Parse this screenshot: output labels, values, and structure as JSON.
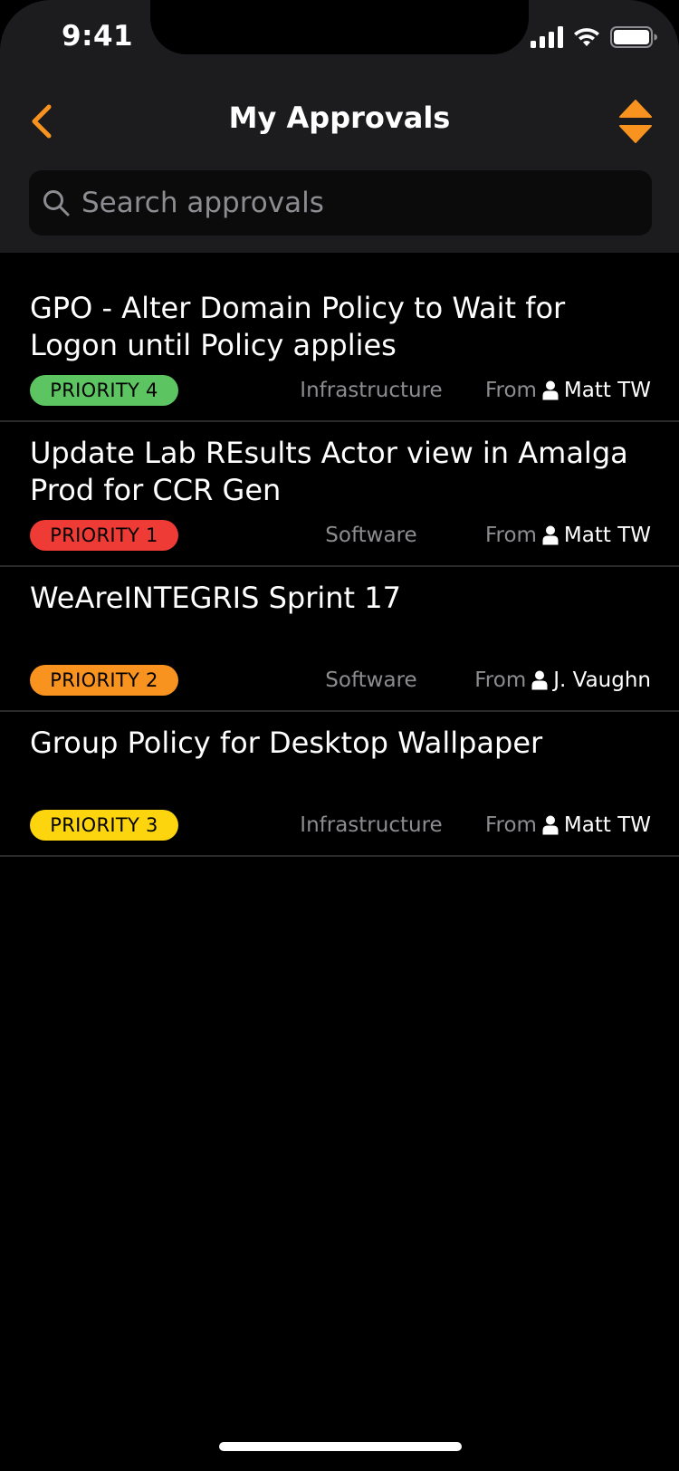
{
  "status_bar": {
    "time": "9:41"
  },
  "nav": {
    "title": "My Approvals",
    "back_icon": "chevron-left-icon",
    "sort_icon": "sort-icon",
    "accent_color": "#f7931e"
  },
  "search": {
    "placeholder": "Search approvals",
    "value": ""
  },
  "approvals": [
    {
      "title": "GPO - Alter Domain Policy to Wait for Logon until Policy applies",
      "priority": "PRIORITY 4",
      "priority_color": "#5cc461",
      "category": "Infrastructure",
      "from_label": "From",
      "from_name": "Matt TW"
    },
    {
      "title": "Update Lab REsults Actor view in Amalga Prod for CCR Gen",
      "priority": "PRIORITY 1",
      "priority_color": "#ef3b36",
      "category": "Software",
      "from_label": "From",
      "from_name": "Matt TW"
    },
    {
      "title": "WeAreINTEGRIS Sprint 17",
      "priority": "PRIORITY 2",
      "priority_color": "#f7931e",
      "category": "Software",
      "from_label": "From",
      "from_name": "J. Vaughn"
    },
    {
      "title": "Group Policy for Desktop Wallpaper",
      "priority": "PRIORITY 3",
      "priority_color": "#fdd50f",
      "category": "Infrastructure",
      "from_label": "From",
      "from_name": "Matt TW"
    }
  ]
}
